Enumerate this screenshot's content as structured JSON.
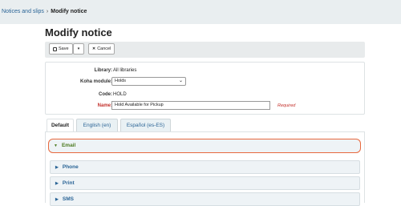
{
  "breadcrumb": {
    "parent": "Notices and slips",
    "separator": "›",
    "current": "Modify notice"
  },
  "page_title": "Modify notice",
  "toolbar": {
    "save_label": "Save",
    "cancel_label": "Cancel"
  },
  "form": {
    "library_label": "Library:",
    "library_value": "All libraries",
    "module_label": "Koha module:",
    "module_value": "Holds",
    "code_label": "Code:",
    "code_value": "HOLD",
    "name_label": "Name:",
    "name_value": "Hold Available for Pickup",
    "required_text": "Required"
  },
  "tabs": [
    {
      "label": "Default"
    },
    {
      "label": "English (en)"
    },
    {
      "label": "Español (es-ES)"
    }
  ],
  "sections": [
    {
      "label": "Email",
      "expanded": true
    },
    {
      "label": "Phone",
      "expanded": false
    },
    {
      "label": "Print",
      "expanded": false
    },
    {
      "label": "SMS",
      "expanded": false
    }
  ],
  "colors": {
    "link": "#2a6496",
    "required": "#c4302b",
    "highlight_outline": "#e8693e",
    "email_section_text": "#4b7a1f"
  }
}
